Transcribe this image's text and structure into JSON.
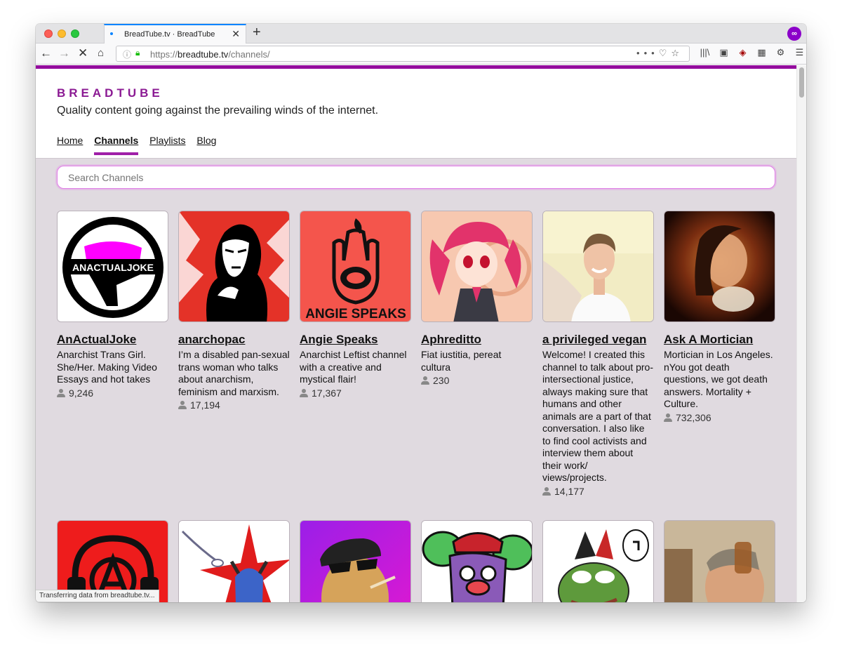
{
  "browser": {
    "tab_title": "BreadTube.tv · BreadTube",
    "url_scheme": "https://",
    "url_domain": "breadtube.tv",
    "url_path": "/channels/",
    "status_text": "Transferring data from breadtube.tv..."
  },
  "site": {
    "logo": "BREADTUBE",
    "tagline": "Quality content going against the prevailing winds of the internet.",
    "nav": [
      "Home",
      "Channels",
      "Playlists",
      "Blog"
    ],
    "active_nav": "Channels",
    "search_placeholder": "Search Channels",
    "accent_color": "#940d9e"
  },
  "channels": [
    {
      "name": "AnActualJoke",
      "description": "Anarchist Trans Girl. She/Her. Making Video Essays and hot takes",
      "subscribers": "9,246",
      "thumb_text": "ANACTUALJOKE"
    },
    {
      "name": "anarchopac",
      "description": "I’m a disabled pan-sexual trans woman who talks about anarchism, feminism and marxism.",
      "subscribers": "17,194"
    },
    {
      "name": "Angie Speaks",
      "description": "Anarchist Leftist channel with a creative and mystical flair!",
      "subscribers": "17,367",
      "thumb_text": "ANGIE SPEAKS"
    },
    {
      "name": "Aphreditto",
      "description": "Fiat iustitia, pereat cultura",
      "subscribers": "230"
    },
    {
      "name": "a privileged vegan",
      "description": "Welcome! I created this channel to talk about pro-intersectional justice, always making sure that humans and other animals are a part of that conversation. I also like to find cool activists and interview them about their work/ views/projects.",
      "subscribers": "14,177"
    },
    {
      "name": "Ask A Mortician",
      "description": "Mortician in Los Angeles. nYou got death questions, we got death answers. Mortality + Culture.",
      "subscribers": "732,306"
    }
  ]
}
